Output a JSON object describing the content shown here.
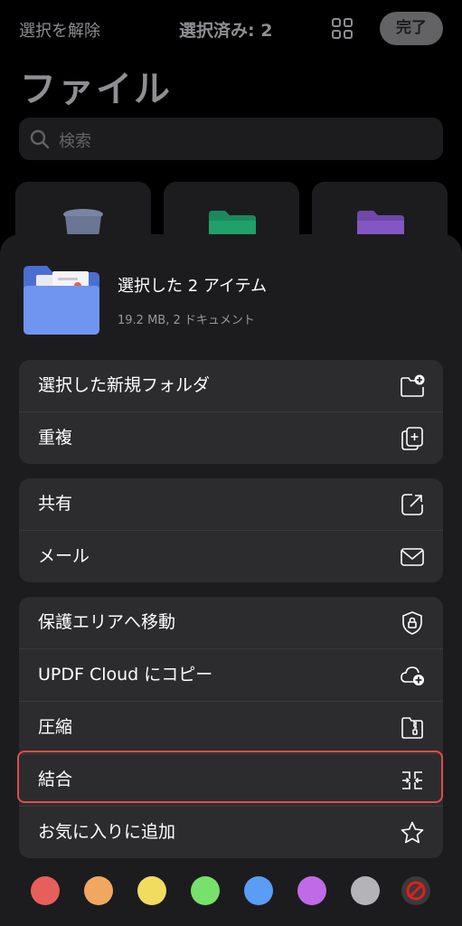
{
  "topbar": {
    "deselect_label": "選択を解除",
    "selected_count_label": "選択済み: 2",
    "grid_icon": "grid-icon",
    "done_label": "完了"
  },
  "page_title": "ファイル",
  "search": {
    "placeholder": "検索",
    "icon": "search-icon"
  },
  "tiles": [
    {
      "icon": "trash-icon",
      "color": "#8e9ab8"
    },
    {
      "icon": "folder-icon",
      "color": "#1f9e6a"
    },
    {
      "icon": "folder-icon",
      "color": "#8a5cc9"
    }
  ],
  "sheet": {
    "header": {
      "title": "選択した 2 アイテム",
      "subtitle": "19.2 MB, 2 ドキュメント",
      "icon": "folder-documents-icon"
    },
    "groups": [
      {
        "items": [
          {
            "label": "選択した新規フォルダ",
            "icon": "new-folder-icon"
          },
          {
            "label": "重複",
            "icon": "duplicate-icon"
          }
        ]
      },
      {
        "items": [
          {
            "label": "共有",
            "icon": "share-icon"
          },
          {
            "label": "メール",
            "icon": "mail-icon"
          }
        ]
      },
      {
        "items": [
          {
            "label": "保護エリアへ移動",
            "icon": "shield-lock-icon"
          },
          {
            "label": "UPDF Cloud にコピー",
            "icon": "cloud-add-icon"
          },
          {
            "label": "圧縮",
            "icon": "compress-icon"
          },
          {
            "label": "結合",
            "icon": "merge-icon"
          },
          {
            "label": "お気に入りに追加",
            "icon": "star-icon"
          }
        ]
      }
    ],
    "color_tags": [
      "#e5605a",
      "#f0a860",
      "#f2dc60",
      "#78e06c",
      "#5b9cf5",
      "#c06ae8",
      "#b3b3b8"
    ],
    "clear_tag_icon": "no-color-icon",
    "highlight_color": "#e24b4b"
  }
}
